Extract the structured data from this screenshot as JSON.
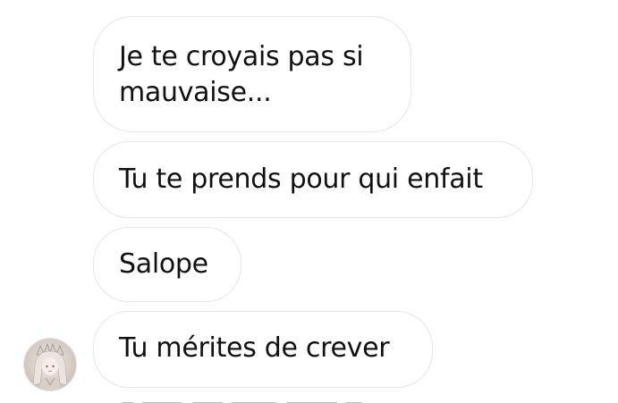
{
  "messages": [
    {
      "line1": "Je te croyais pas si",
      "line2": "mauvaise..."
    },
    {
      "text": "Tu te prends pour qui enfait"
    },
    {
      "text": "Salope"
    },
    {
      "text": "Tu mérites de crever"
    }
  ],
  "sender": {
    "avatar_icon": "user-avatar-photo"
  }
}
